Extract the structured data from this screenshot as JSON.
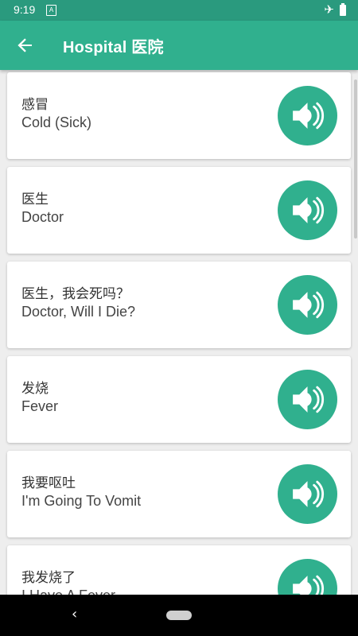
{
  "status_bar": {
    "time": "9:19",
    "notification_glyph": "A"
  },
  "app_bar": {
    "title": "Hospital 医院",
    "back_icon": "arrow-back-icon"
  },
  "phrases": [
    {
      "zh": "感冒",
      "en": "Cold (Sick)"
    },
    {
      "zh": "医生",
      "en": "Doctor"
    },
    {
      "zh": "医生，我会死吗？",
      "en": "Doctor, Will I Die?"
    },
    {
      "zh": "发烧",
      "en": "Fever"
    },
    {
      "zh": "我要呕吐",
      "en": "I'm Going To Vomit"
    },
    {
      "zh": "我发烧了",
      "en": "I Have A Fever"
    }
  ],
  "colors": {
    "primary": "#30b08e",
    "status_bar": "#2a9a7e",
    "background": "#eeeeee"
  }
}
